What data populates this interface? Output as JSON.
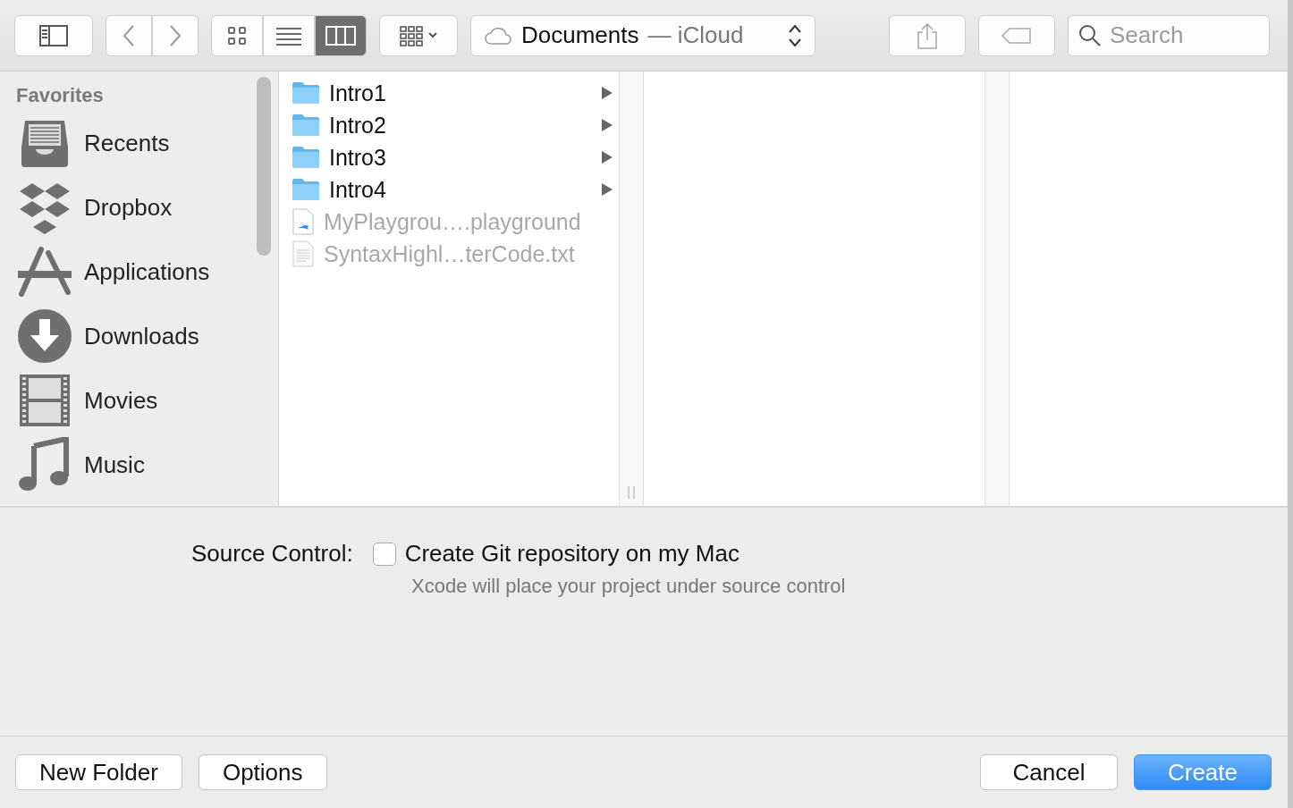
{
  "toolbar": {
    "view_modes": [
      {
        "kind": "icons",
        "selected": false
      },
      {
        "kind": "list",
        "selected": false
      },
      {
        "kind": "columns",
        "selected": true
      }
    ],
    "location": {
      "name": "Documents",
      "service": "— iCloud"
    },
    "search": {
      "placeholder": "Search"
    }
  },
  "sidebar": {
    "heading": "Favorites",
    "items": [
      {
        "kind": "recents",
        "label": "Recents"
      },
      {
        "kind": "dropbox",
        "label": "Dropbox"
      },
      {
        "kind": "applications",
        "label": "Applications"
      },
      {
        "kind": "downloads",
        "label": "Downloads"
      },
      {
        "kind": "movies",
        "label": "Movies"
      },
      {
        "kind": "music",
        "label": "Music"
      }
    ]
  },
  "files": [
    {
      "kind": "folder",
      "name": "Intro1",
      "disabled": false
    },
    {
      "kind": "folder",
      "name": "Intro2",
      "disabled": false
    },
    {
      "kind": "folder",
      "name": "Intro3",
      "disabled": false
    },
    {
      "kind": "folder",
      "name": "Intro4",
      "disabled": false
    },
    {
      "kind": "playground",
      "name": "MyPlaygrou….playground",
      "disabled": true
    },
    {
      "kind": "text",
      "name": "SyntaxHighl…terCode.txt",
      "disabled": true
    }
  ],
  "source_control": {
    "label": "Source Control:",
    "checked": false,
    "option": "Create Git repository on my Mac",
    "hint": "Xcode will place your project under source control"
  },
  "left_buttons": [
    {
      "label": "New Folder",
      "default": false
    },
    {
      "label": "Options",
      "default": false
    }
  ],
  "right_buttons": [
    {
      "label": "Cancel",
      "default": false
    },
    {
      "label": "Create",
      "default": true
    }
  ]
}
